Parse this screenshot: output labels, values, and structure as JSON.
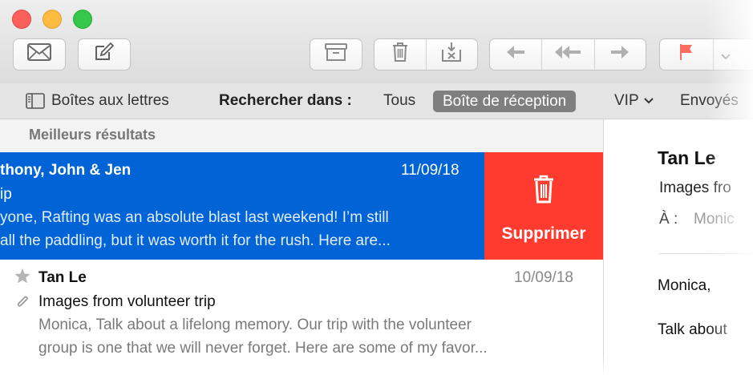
{
  "toolbar": {
    "icons": {
      "get_mail": "envelope-icon",
      "compose": "compose-icon",
      "archive": "archive-icon",
      "delete": "trash-icon",
      "junk": "junk-icon",
      "reply": "reply-icon",
      "reply_all": "reply-all-icon",
      "forward": "forward-icon",
      "flag": "flag-icon",
      "flag_menu": "chevron-down-icon"
    },
    "colors": {
      "flag": "#ff3b30"
    }
  },
  "favorites_bar": {
    "mailboxes_label": "Boîtes aux lettres",
    "search_in_label": "Rechercher dans :",
    "scope_all": "Tous",
    "scope_inbox": "Boîte de réception",
    "scope_vip": "VIP",
    "scope_sent": "Envoyés"
  },
  "results": {
    "section_header": "Meilleurs résultats",
    "messages": [
      {
        "sender": "thony, John & Jen",
        "date": "11/09/18",
        "subject": "ip",
        "preview_line1": "yone, Rafting was an absolute blast last weekend! I’m still",
        "preview_line2": "all the paddling, but it was worth it for the rush. Here are..."
      },
      {
        "sender": "Tan Le",
        "date": "10/09/18",
        "subject": "Images from volunteer trip",
        "preview_line1": "Monica, Talk about a lifelong memory. Our trip with the volunteer",
        "preview_line2": "group is one that we will never forget.  Here are some of my favor..."
      }
    ],
    "delete_action_label": "Supprimer",
    "colors": {
      "selected": "#0063d6",
      "delete": "#ff3b30"
    }
  },
  "detail": {
    "sender": "Tan Le",
    "subject": "Images fro",
    "to_label": "À :",
    "to_value": "Monic",
    "greeting": "Monica,",
    "body_start": "Talk about"
  }
}
